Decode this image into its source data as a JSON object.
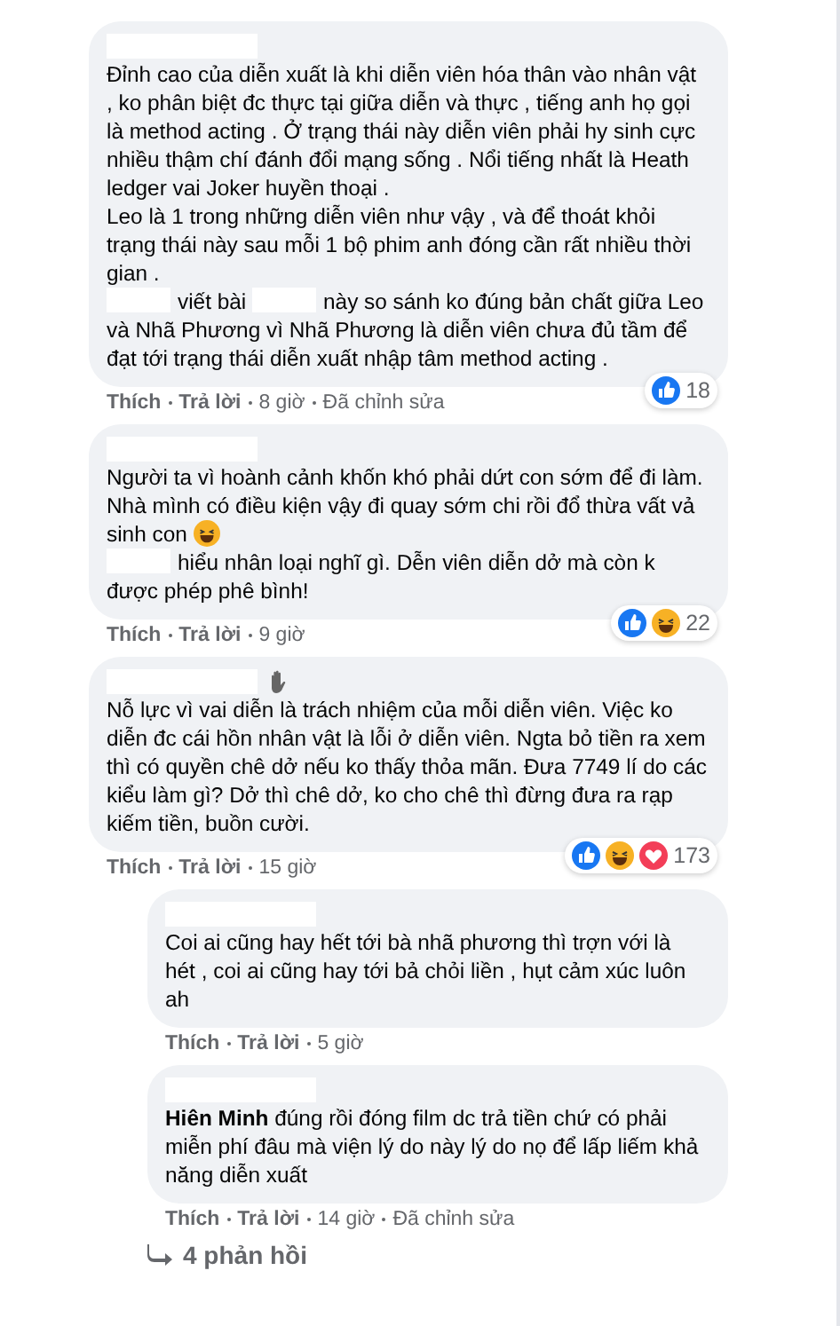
{
  "comments": [
    {
      "reply": false,
      "name_icon": false,
      "paragraphs": [
        [
          {
            "kind": "text",
            "text": "Đỉnh cao của diễn xuất là khi diễn viên hóa thân vào nhân vật , ko phân biệt đc thực tại giữa diễn và thực , tiếng anh họ gọi là method acting . Ở trạng thái này diễn viên phải hy sinh cực nhiều thậm chí đánh đổi mạng sống . Nổi tiếng nhất là Heath ledger vai Joker huyền thoại ."
          }
        ],
        [
          {
            "kind": "text",
            "text": "Leo là 1 trong những diễn viên như vậy , và để thoát khỏi trạng thái này sau mỗi 1 bộ phim anh đóng cần rất nhiều thời gian ."
          }
        ],
        [
          {
            "kind": "redacted"
          },
          {
            "kind": "text",
            "text": "viết bài"
          },
          {
            "kind": "redacted"
          },
          {
            "kind": "text",
            "text": "này so sánh ko đúng bản chất giữa Leo và Nhã Phương vì Nhã Phương là diễn viên chưa đủ tầm để đạt tới trạng thái diễn xuất nhập tâm method acting ."
          }
        ]
      ],
      "reactions": {
        "types": [
          {
            "kind": "like"
          }
        ],
        "count": "18"
      },
      "actions": [
        "Thích",
        "Trả lời"
      ],
      "time": "8 giờ",
      "edited": "Đã chỉnh sửa"
    },
    {
      "reply": false,
      "name_icon": false,
      "paragraphs": [
        [
          {
            "kind": "text",
            "text": "Người ta vì hoành cảnh khốn khó phải dứt con sớm để đi làm. Nhà mình có điều kiện vậy đi quay sớm chi rồi đổ thừa vất vả sinh con"
          },
          {
            "kind": "emoji"
          }
        ],
        [
          {
            "kind": "redacted"
          },
          {
            "kind": "text",
            "text": "hiểu nhân loại nghĩ gì. Dễn viên diễn dở mà còn k được phép phê bình!"
          }
        ]
      ],
      "reactions": {
        "types": [
          {
            "kind": "like"
          },
          {
            "kind": "haha"
          }
        ],
        "count": "22"
      },
      "actions": [
        "Thích",
        "Trả lời"
      ],
      "time": "9 giờ"
    },
    {
      "reply": false,
      "name_icon": true,
      "paragraphs": [
        [
          {
            "kind": "text",
            "text": "Nỗ lực vì vai diễn là trách nhiệm của mỗi diễn viên. Việc ko diễn đc cái hồn nhân vật là lỗi ở diễn viên. Ngta bỏ tiền ra xem thì có quyền chê dở nếu ko thấy thỏa mãn. Đưa 7749 lí do các kiểu làm gì? Dở thì chê dở, ko cho chê thì đừng đưa ra rạp kiếm tiền, buồn cười."
          }
        ]
      ],
      "reactions": {
        "types": [
          {
            "kind": "like"
          },
          {
            "kind": "haha"
          },
          {
            "kind": "love"
          }
        ],
        "count": "173"
      },
      "actions": [
        "Thích",
        "Trả lời"
      ],
      "time": "15 giờ"
    },
    {
      "reply": true,
      "name_icon": false,
      "paragraphs": [
        [
          {
            "kind": "text",
            "text": "Coi ai cũng hay hết tới bà nhã phương thì trợn với là hét , coi ai cũng hay tới bả chỏi liền , hụt cảm xúc luôn ah"
          }
        ]
      ],
      "actions": [
        "Thích",
        "Trả lời"
      ],
      "time": "5 giờ"
    },
    {
      "reply": true,
      "name_icon": false,
      "paragraphs": [
        [
          {
            "kind": "text",
            "text": "**Hiên Minh** đúng rồi đóng film dc trả tiền chứ có phải miễn phí đâu mà viện lý do này lý do nọ để lấp liếm khả năng diễn xuất"
          }
        ]
      ],
      "actions": [
        "Thích",
        "Trả lời"
      ],
      "time": "14 giờ",
      "edited": "Đã chỉnh sửa"
    }
  ],
  "more_replies": "4 phản hồi"
}
